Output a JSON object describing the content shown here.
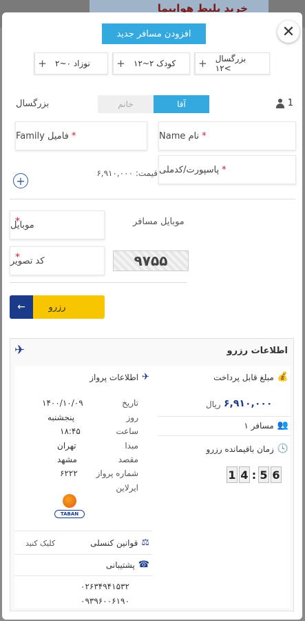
{
  "background": {
    "banner_text": "خرید بلیط هواپیما"
  },
  "modal": {
    "close_icon": "close-icon",
    "add_passenger_button": "افزودن مسافر جدید",
    "passenger_types": [
      {
        "label": "بزرگسال ۱۲<",
        "plus": "+"
      },
      {
        "label": "کودک ۲~۱۲",
        "plus": "+"
      },
      {
        "label": "۲~۰ نوزاد",
        "plus": "+"
      }
    ],
    "passenger": {
      "index": "1",
      "type_label": "بزرگسال",
      "gender_male": "آقا",
      "gender_female": "خانم",
      "name_placeholder": "نام Name",
      "family_placeholder": "فامیل Family",
      "passport_placeholder": "پاسپورت/کدملی",
      "price_text": "قیمت: ۶,۹۱۰,۰۰۰",
      "add_icon": "plus-circle-icon"
    },
    "contact": {
      "mobile_label": "موبایل مسافر",
      "mobile_placeholder": "موبایل",
      "captcha_placeholder": "کد تصویر",
      "captcha_value": "۹۷۵۵"
    },
    "book_button": "رزرو",
    "book_arrow": "←",
    "required_mark": "*"
  },
  "booking_info": {
    "title": "اطلاعات رزرو",
    "flight": {
      "header": "اطلاعات پرواز",
      "fields": [
        {
          "label": "تاریخ",
          "value": "۱۴۰۰/۱۰/۰۹"
        },
        {
          "label": "روز",
          "value": "پنجشنبه"
        },
        {
          "label": "ساعت",
          "value": "۱۸:۴۵"
        },
        {
          "label": "مبدا",
          "value": "تهران"
        },
        {
          "label": "مقصد",
          "value": "مشهد"
        },
        {
          "label": "شماره پرواز",
          "value": "۶۲۲۲"
        },
        {
          "label": "ایرلاین",
          "value": ""
        }
      ],
      "airline_logo_text": "TABAN"
    },
    "payable": {
      "label": "مبلغ قابل پرداخت",
      "amount": "۶,۹۱۰,۰۰۰",
      "unit": "ریال"
    },
    "passenger_count": "۱ مسافر",
    "remaining_time": {
      "label": "زمان باقیمانده رزرو",
      "digits": [
        "1",
        "4",
        ":",
        "5",
        "6"
      ]
    },
    "consular": {
      "label": "قوانین کنسلی",
      "link": "کلیک کنید"
    },
    "support": {
      "label": "پشتیبانی",
      "phones": [
        "۰۲۶۳۴۹۴۱۵۳۲",
        "۰۹۳۹۶۰۰۶۱۹۰"
      ]
    }
  },
  "colors": {
    "accent": "#33a9e0",
    "book": "#f7c600",
    "navy": "#1a3a8a",
    "required": "#d21f2e"
  }
}
